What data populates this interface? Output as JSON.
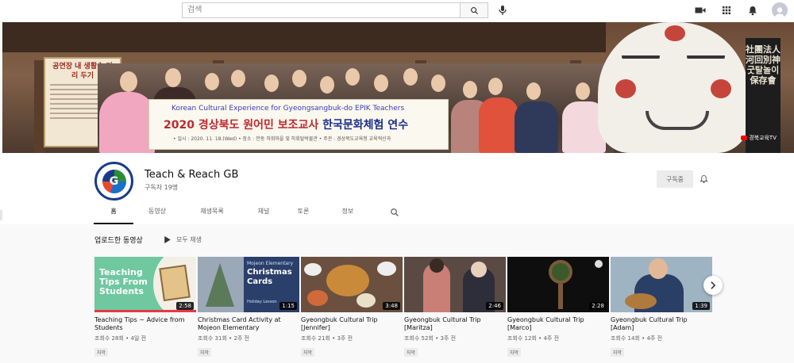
{
  "search": {
    "placeholder": "검색"
  },
  "channel": {
    "name": "Teach & Reach GB",
    "subscribers": "구독자 19명",
    "subscribe_label": "구독중",
    "avatar_letter": "G"
  },
  "banner": {
    "board_line1": "Korean Cultural Experience for Gyeongsangbuk-do EPIK Teachers",
    "board_line2_red": "2020 경상북도 원어민 보조교사",
    "board_line2_blue": "한국문화체험 연수",
    "board_line3": "• 일시 : 2020. 11. 18.(Wed)    • 장소 : 안동 하회마을 및 하회탈박물관    • 주관 : 경상북도교육청 교육혁신과",
    "left_sign_big": "공연장 내 생활속 거리 두기",
    "right_sign": "社團法人 河回別神굿탈놀이保存會",
    "watermark": "경북교육TV"
  },
  "tabs": [
    {
      "label": "홈",
      "active": true
    },
    {
      "label": "동영상",
      "active": false
    },
    {
      "label": "재생목록",
      "active": false
    },
    {
      "label": "채널",
      "active": false
    },
    {
      "label": "토론",
      "active": false
    },
    {
      "label": "정보",
      "active": false
    }
  ],
  "uploads": {
    "heading": "업로드한 동영상",
    "play_all": "모두 재생"
  },
  "videos": [
    {
      "title": "Teaching Tips ~ Advice from Students",
      "meta": "조회수 28회 • 4일 전",
      "duration": "2:58",
      "cc": "자막",
      "thumb_text": "Teaching Tips From Students"
    },
    {
      "title": "Christmas Card Activity at Mojeon Elementary",
      "meta": "조회수 31회 • 2주 전",
      "duration": "1:15",
      "cc": "자막",
      "thumb_text_small": "Mojeon Elementary",
      "thumb_text": "Christmas Cards",
      "thumb_text_foot": "Holiday Lesson"
    },
    {
      "title": "Gyeongbuk Cultural Trip [Jennifer]",
      "meta": "조회수 21회 • 3주 전",
      "duration": "3:48",
      "cc": "자막"
    },
    {
      "title": "Gyeongbuk Cultural Trip [Maritza]",
      "meta": "조회수 52회 • 3주 전",
      "duration": "2:46",
      "cc": "자막"
    },
    {
      "title": "Gyeongbuk Cultural Trip [Marco]",
      "meta": "조회수 12회 • 4주 전",
      "duration": "2:28",
      "cc": "자막"
    },
    {
      "title": "Gyeongbuk Cultural Trip [Adam]",
      "meta": "조회수 14회 • 4주 전",
      "duration": "1:39",
      "cc": "자막"
    }
  ],
  "colors": {
    "accent_red": "#ff0000",
    "text": "#0f0f0f",
    "meta": "#606060"
  }
}
